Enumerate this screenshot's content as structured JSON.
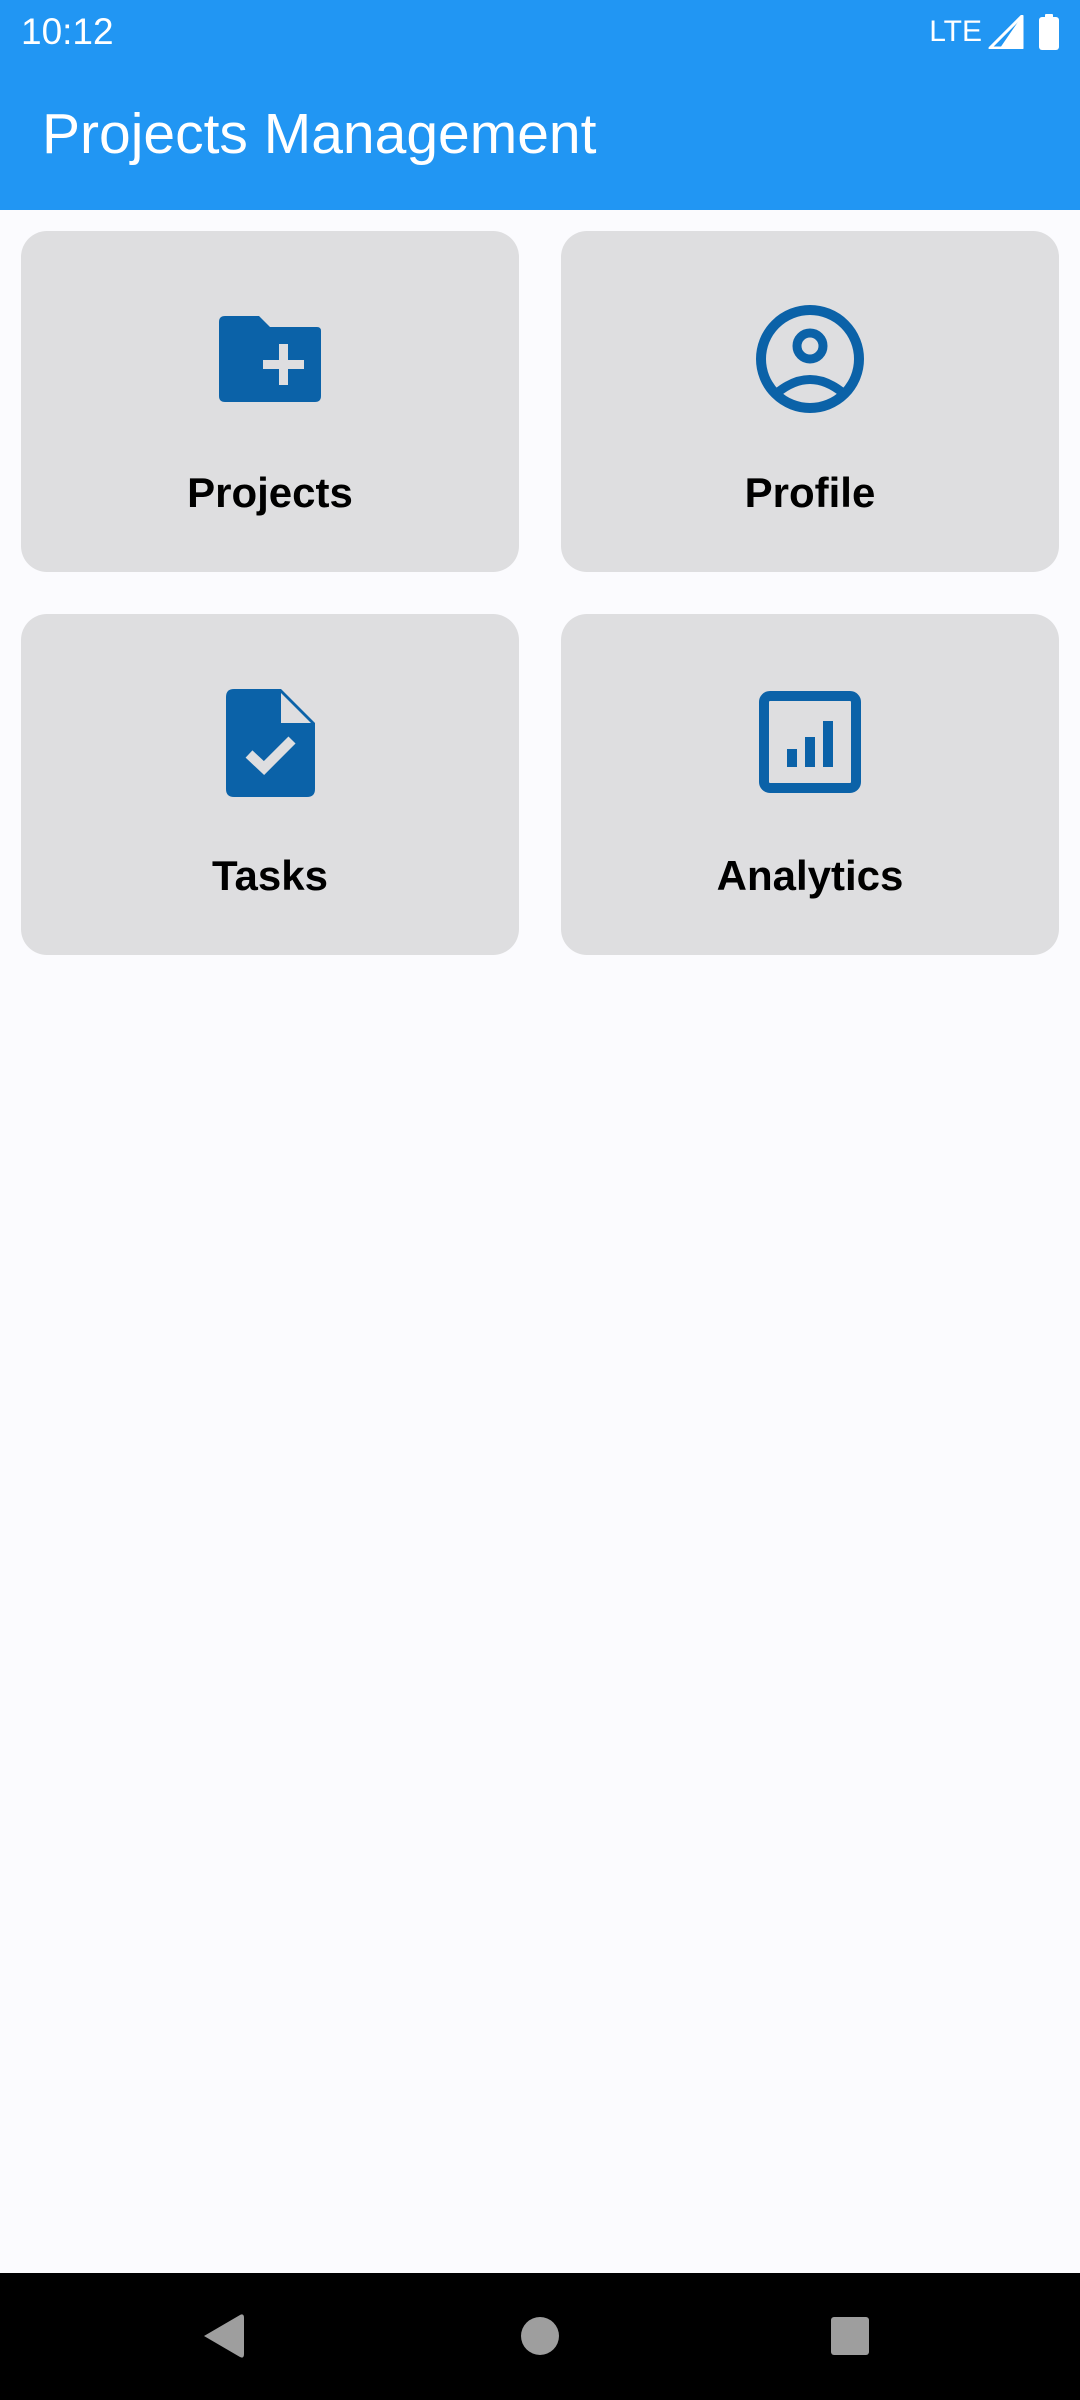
{
  "status_bar": {
    "time": "10:12",
    "network": "LTE",
    "icons": [
      "signal-icon",
      "battery-icon"
    ],
    "background": "#2196F3"
  },
  "app_bar": {
    "title": "Projects Management",
    "background": "#2196F3"
  },
  "cards": [
    {
      "label": "Projects",
      "icon": "folder-add-icon"
    },
    {
      "label": "Profile",
      "icon": "account-circle-icon"
    },
    {
      "label": "Tasks",
      "icon": "task-document-icon"
    },
    {
      "label": "Analytics",
      "icon": "analytics-icon"
    }
  ],
  "colors": {
    "accent": "#2196F3",
    "icon": "#0B62A8",
    "card_background": "#DEDEE0",
    "page_background": "#FBFBFE"
  },
  "nav_bar": {
    "buttons": [
      "back-icon",
      "home-icon",
      "recents-icon"
    ]
  }
}
